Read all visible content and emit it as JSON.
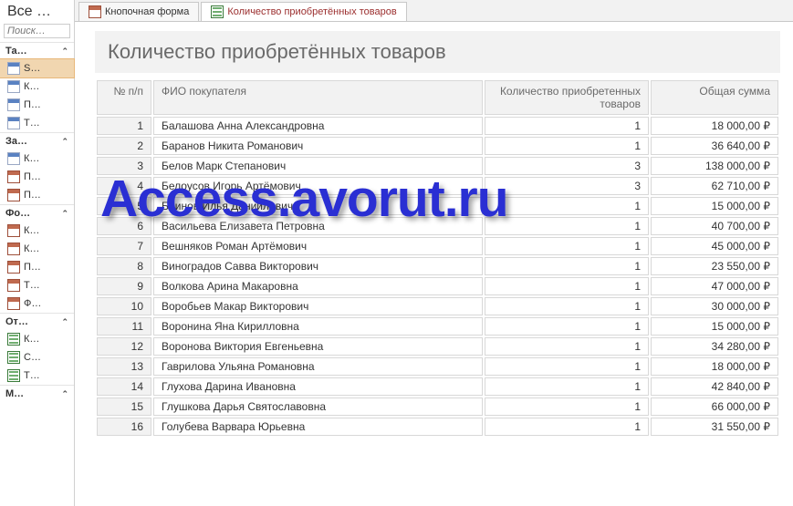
{
  "sidebar": {
    "title": "Все …",
    "search_placeholder": "Поиск…",
    "sections": [
      {
        "header": "Та…",
        "items": [
          {
            "label": "S…",
            "icon": "table",
            "selected": true
          },
          {
            "label": "К…",
            "icon": "table"
          },
          {
            "label": "П…",
            "icon": "table"
          },
          {
            "label": "Т…",
            "icon": "table"
          }
        ]
      },
      {
        "header": "За…",
        "items": [
          {
            "label": "К…",
            "icon": "table"
          },
          {
            "label": "П…",
            "icon": "form"
          },
          {
            "label": "П…",
            "icon": "form"
          }
        ]
      },
      {
        "header": "Фо…",
        "items": [
          {
            "label": "К…",
            "icon": "form"
          },
          {
            "label": "К…",
            "icon": "form"
          },
          {
            "label": "П…",
            "icon": "form"
          },
          {
            "label": "Т…",
            "icon": "form"
          },
          {
            "label": "Ф…",
            "icon": "form"
          }
        ]
      },
      {
        "header": "От…",
        "items": [
          {
            "label": "К…",
            "icon": "report"
          },
          {
            "label": "С…",
            "icon": "report"
          },
          {
            "label": "Т…",
            "icon": "report"
          }
        ]
      },
      {
        "header": "М…",
        "items": []
      }
    ]
  },
  "tabs": [
    {
      "label": "Кнопочная форма",
      "active": false,
      "icon": "form"
    },
    {
      "label": "Количество приобретённых товаров",
      "active": true,
      "icon": "report"
    }
  ],
  "report": {
    "title": "Количество приобретённых товаров",
    "columns": {
      "n": "№ п/п",
      "name": "ФИО покупателя",
      "qty": "Количество приобретенных товаров",
      "sum": "Общая сумма"
    },
    "rows": [
      {
        "n": 1,
        "name": "Балашова Анна Александровна",
        "qty": 1,
        "sum": "18 000,00 ₽"
      },
      {
        "n": 2,
        "name": "Баранов Никита Романович",
        "qty": 1,
        "sum": "36 640,00 ₽"
      },
      {
        "n": 3,
        "name": "Белов Марк Степанович",
        "qty": 3,
        "sum": "138 000,00 ₽"
      },
      {
        "n": 4,
        "name": "Белоусов Игорь Артёмович",
        "qty": 3,
        "sum": "62 710,00 ₽"
      },
      {
        "n": 5,
        "name": "Блинов Илья Даниилович",
        "qty": 1,
        "sum": "15 000,00 ₽"
      },
      {
        "n": 6,
        "name": "Васильева Елизавета Петровна",
        "qty": 1,
        "sum": "40 700,00 ₽"
      },
      {
        "n": 7,
        "name": "Вешняков Роман Артёмович",
        "qty": 1,
        "sum": "45 000,00 ₽"
      },
      {
        "n": 8,
        "name": "Виноградов Савва Викторович",
        "qty": 1,
        "sum": "23 550,00 ₽"
      },
      {
        "n": 9,
        "name": "Волкова Арина Макаровна",
        "qty": 1,
        "sum": "47 000,00 ₽"
      },
      {
        "n": 10,
        "name": "Воробьев Макар Викторович",
        "qty": 1,
        "sum": "30 000,00 ₽"
      },
      {
        "n": 11,
        "name": "Воронина Яна Кирилловна",
        "qty": 1,
        "sum": "15 000,00 ₽"
      },
      {
        "n": 12,
        "name": "Воронова Виктория Евгеньевна",
        "qty": 1,
        "sum": "34 280,00 ₽"
      },
      {
        "n": 13,
        "name": "Гаврилова Ульяна Романовна",
        "qty": 1,
        "sum": "18 000,00 ₽"
      },
      {
        "n": 14,
        "name": "Глухова Дарина Ивановна",
        "qty": 1,
        "sum": "42 840,00 ₽"
      },
      {
        "n": 15,
        "name": "Глушкова Дарья Святославовна",
        "qty": 1,
        "sum": "66 000,00 ₽"
      },
      {
        "n": 16,
        "name": "Голубева Варвара Юрьевна",
        "qty": 1,
        "sum": "31 550,00 ₽"
      }
    ]
  },
  "watermark": "Access.avorut.ru"
}
